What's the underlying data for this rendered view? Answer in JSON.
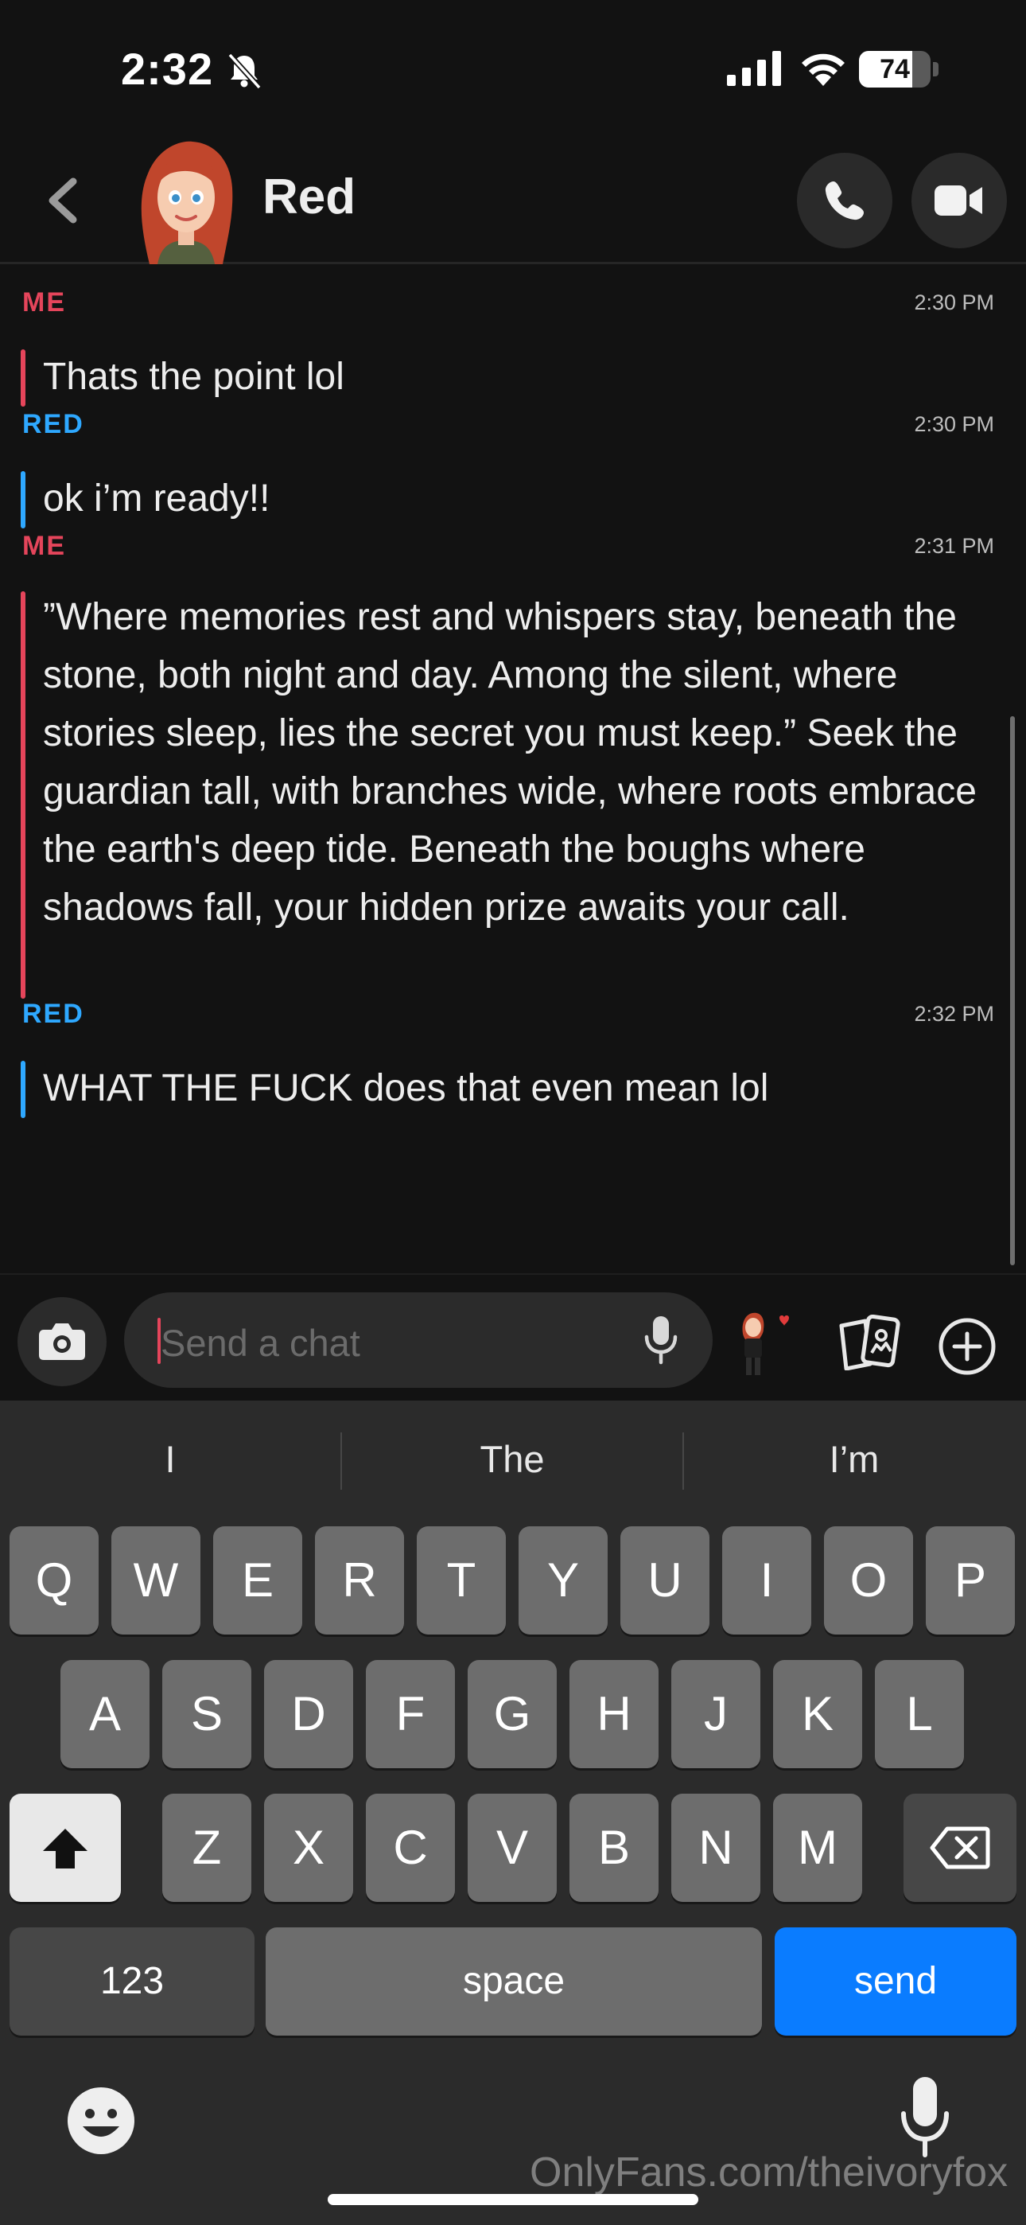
{
  "status_bar": {
    "time": "2:32",
    "battery_level": "74",
    "battery_fraction": 0.74
  },
  "header": {
    "contact_name": "Red"
  },
  "messages": [
    {
      "sender": "ME",
      "time": "2:30 PM",
      "text": "Thats the point lol"
    },
    {
      "sender": "RED",
      "time": "2:30 PM",
      "text": "ok i’m ready!!"
    },
    {
      "sender": "ME",
      "time": "2:31 PM",
      "text": "”Where memories rest and whispers stay, beneath the stone, both night and day. Among the silent, where stories sleep, lies the secret you must keep.” Seek the guardian tall, with branches wide, where roots embrace the earth's deep tide. Beneath the boughs where shadows fall, your hidden prize awaits your call."
    },
    {
      "sender": "RED",
      "time": "2:32 PM",
      "text": "WHAT THE FUCK does that even mean lol"
    }
  ],
  "composer": {
    "placeholder": "Send a chat"
  },
  "keyboard": {
    "suggestions": [
      "I",
      "The",
      "I’m"
    ],
    "row1": [
      "Q",
      "W",
      "E",
      "R",
      "T",
      "Y",
      "U",
      "I",
      "O",
      "P"
    ],
    "row2": [
      "A",
      "S",
      "D",
      "F",
      "G",
      "H",
      "J",
      "K",
      "L"
    ],
    "row3": [
      "Z",
      "X",
      "C",
      "V",
      "B",
      "N",
      "M"
    ],
    "numbers_label": "123",
    "space_label": "space",
    "send_label": "send"
  },
  "watermark": "OnlyFans.com/theivoryfox",
  "colors": {
    "me": "#e5455b",
    "red": "#2ea8ff",
    "send": "#0a7cff"
  },
  "icons": [
    "back-chevron-icon",
    "phone-icon",
    "video-camera-icon",
    "camera-icon",
    "microphone-icon",
    "bitmoji-icon",
    "cards-icon",
    "plus-icon",
    "shift-icon",
    "backspace-icon",
    "emoji-icon",
    "bell-slash-icon",
    "signal-icon",
    "wifi-icon"
  ]
}
